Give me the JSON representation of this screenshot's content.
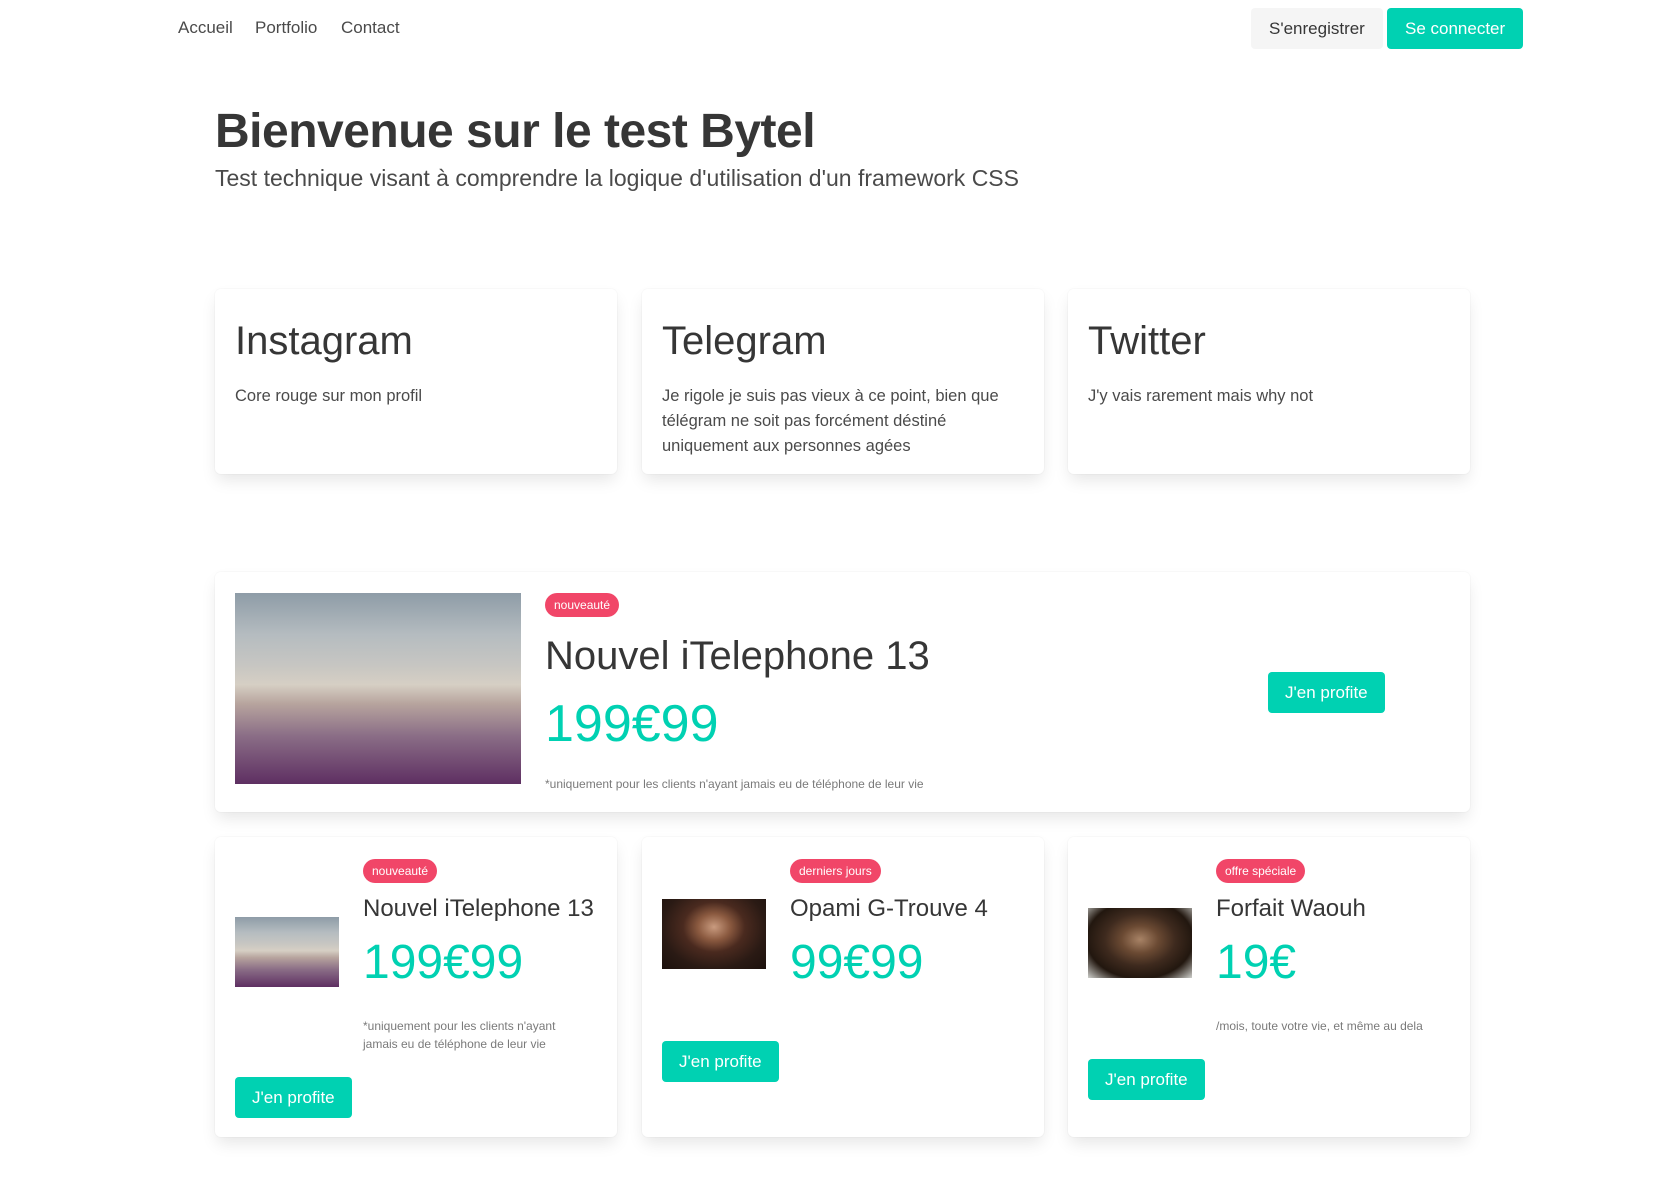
{
  "nav": {
    "links": [
      "Accueil",
      "Portfolio",
      "Contact"
    ],
    "register_label": "S'enregistrer",
    "login_label": "Se connecter"
  },
  "hero": {
    "title": "Bienvenue sur le test Bytel",
    "subtitle": "Test technique visant à comprendre la logique d'utilisation d'un framework CSS"
  },
  "social": [
    {
      "title": "Instagram",
      "text": "Core rouge sur mon profil"
    },
    {
      "title": "Telegram",
      "text": "Je rigole je suis pas vieux à ce point, bien que télégram ne soit pas forcément déstiné uniquement aux personnes agées"
    },
    {
      "title": "Twitter",
      "text": "J'y vais rarement mais why not"
    }
  ],
  "featured": {
    "tag": "nouveauté",
    "title": "Nouvel iTelephone 13",
    "price": "199€99",
    "note": "*uniquement pour les clients n'ayant jamais eu de téléphone de leur vie",
    "cta": "J'en profite"
  },
  "offers": [
    {
      "tag": "nouveauté",
      "title": "Nouvel iTelephone 13",
      "price": "199€99",
      "note": "*uniquement pour les clients n'ayant jamais eu de téléphone de leur vie",
      "cta": "J'en profite"
    },
    {
      "tag": "derniers jours",
      "title": "Opami G-Trouve 4",
      "price": "99€99",
      "cta": "J'en profite"
    },
    {
      "tag": "offre spéciale",
      "title": "Forfait Waouh",
      "price": "19€",
      "note": "/mois, toute votre vie, et même au dela",
      "cta": "J'en profite"
    }
  ],
  "colors": {
    "primary": "#00d1b2",
    "danger": "#f14668",
    "text": "#363636"
  }
}
